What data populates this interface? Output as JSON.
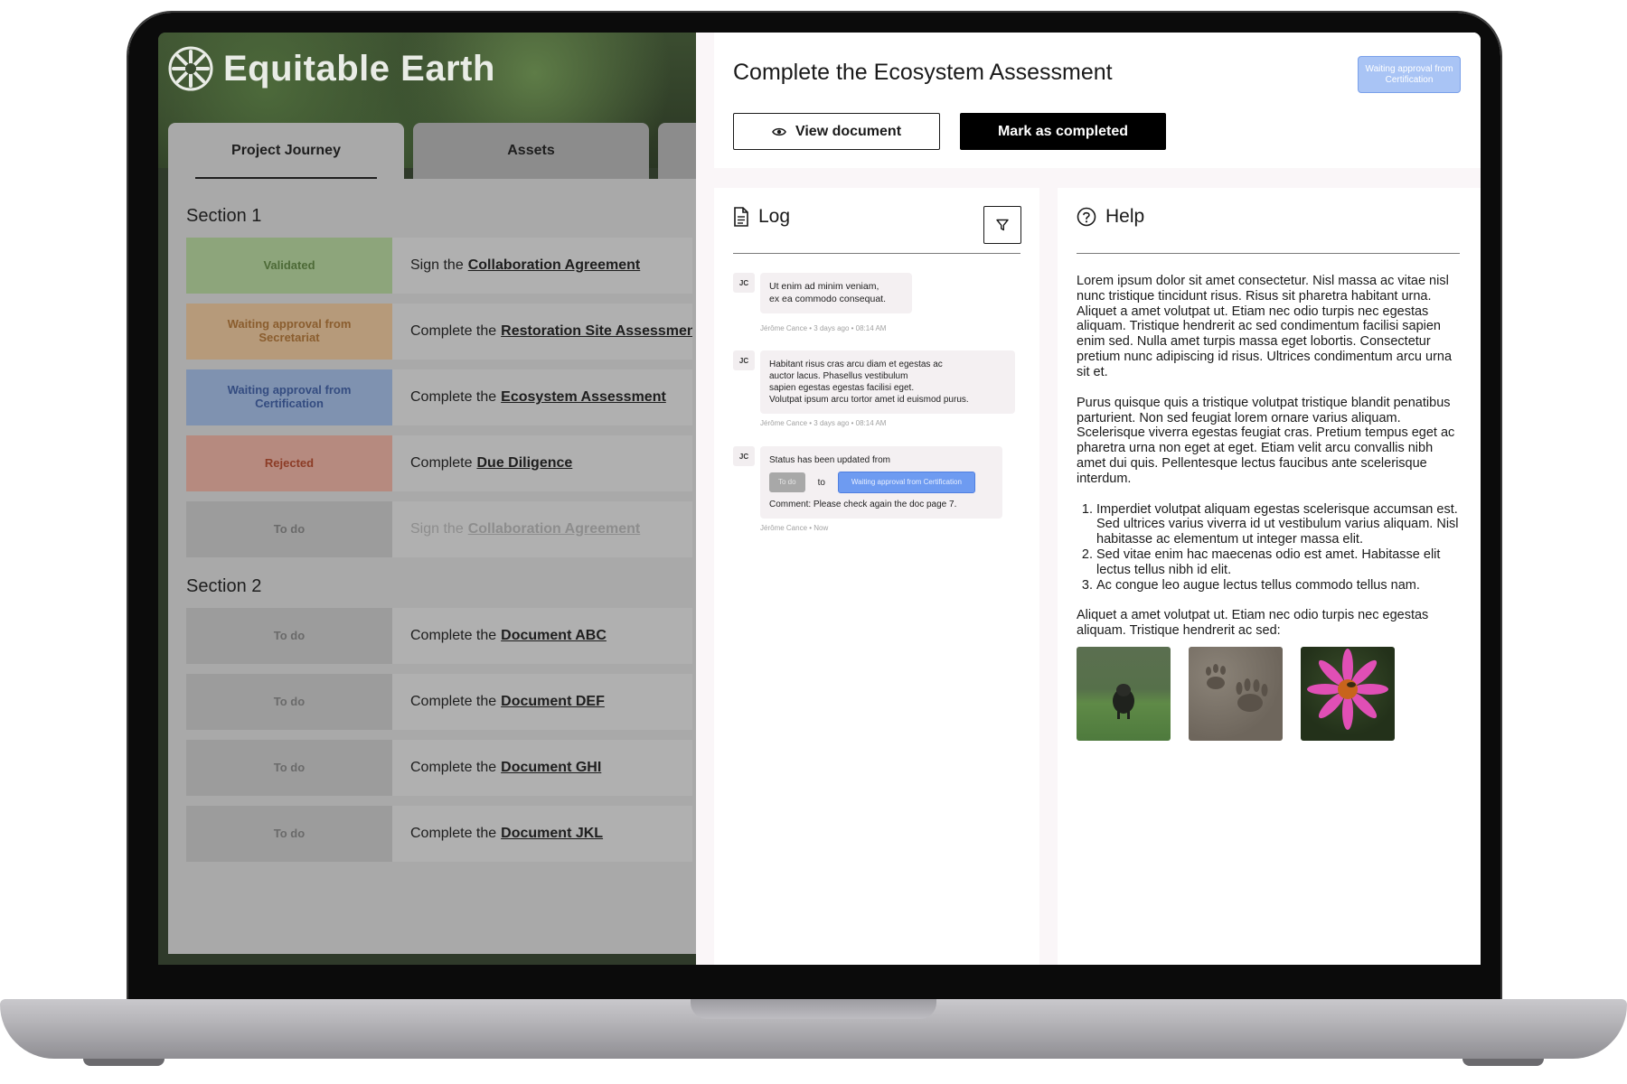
{
  "app": {
    "logo_text": "Equitable Earth",
    "tabs": [
      "Project Journey",
      "Assets"
    ]
  },
  "journey": {
    "sections": [
      {
        "title": "Section 1",
        "rows": [
          {
            "status": "Validated",
            "prefix": "Sign the",
            "doc": "Collaboration Agreement"
          },
          {
            "status": "Waiting approval from Secretariat",
            "prefix": "Complete the",
            "doc": "Restoration Site Assessment"
          },
          {
            "status": "Waiting approval from Certification",
            "prefix": "Complete the",
            "doc": "Ecosystem Assessment"
          },
          {
            "status": "Rejected",
            "prefix": "Complete",
            "doc": "Due Diligence"
          },
          {
            "status": "To do",
            "prefix": "Sign the",
            "doc": "Collaboration Agreement"
          }
        ]
      },
      {
        "title": "Section 2",
        "rows": [
          {
            "status": "To do",
            "prefix": "Complete the",
            "doc": "Document ABC"
          },
          {
            "status": "To do",
            "prefix": "Complete the",
            "doc": "Document DEF"
          },
          {
            "status": "To do",
            "prefix": "Complete the",
            "doc": "Document GHI"
          },
          {
            "status": "To do",
            "prefix": "Complete the",
            "doc": "Document JKL"
          }
        ]
      }
    ]
  },
  "detail": {
    "title": "Complete the Ecosystem Assessment",
    "badge": "Waiting approval from Certification",
    "view_button": "View document",
    "complete_button": "Mark as completed"
  },
  "log": {
    "title": "Log",
    "entries": [
      {
        "initials": "JC",
        "lines": [
          "Ut enim ad minim veniam,",
          "ex ea commodo consequat."
        ],
        "meta": "Jérôme Cance • 3 days ago • 08:14 AM"
      },
      {
        "initials": "JC",
        "lines": [
          "Habitant risus cras arcu diam et egestas ac",
          "auctor lacus. Phasellus vestibulum",
          "sapien egestas egestas facilisi eget.",
          "Volutpat ipsum arcu tortor amet id euismod purus."
        ],
        "meta": "Jérôme Cance • 3 days ago • 08:14 AM"
      },
      {
        "initials": "JC",
        "status_text": "Status has been updated from",
        "from": "To do",
        "to_word": "to",
        "to": "Waiting approval from Certification",
        "comment": "Comment: Please check again the doc page 7.",
        "meta": "Jérôme Cance • Now"
      }
    ]
  },
  "help": {
    "title": "Help",
    "p1": "Lorem ipsum dolor sit amet consectetur. Nisl massa ac vitae nisl nunc tristique tincidunt risus. Risus sit pharetra habitant urna. Aliquet a amet volutpat ut. Etiam nec odio turpis nec egestas aliquam. Tristique hendrerit ac sed condimentum facilisi sapien enim sed. Nulla amet turpis massa eget lobortis. Consectetur pretium nunc adipiscing id risus. Ultrices condimentum arcu urna sit et.",
    "p2": "Purus quisque quis a tristique volutpat tristique blandit penatibus parturient. Non sed feugiat lorem ornare varius aliquam. Scelerisque viverra egestas feugiat cras. Pretium tempus eget ac pharetra urna non eget at eget. Etiam velit arcu convallis nibh amet dui quis. Pellentesque lectus faucibus ante scelerisque interdum.",
    "list": [
      "Imperdiet volutpat aliquam egestas scelerisque accumsan est. Sed ultrices varius viverra id ut vestibulum varius aliquam. Nisl habitasse ac elementum ut integer massa elit.",
      "Sed vitae enim hac maecenas odio est amet. Habitasse elit lectus tellus nibh id elit.",
      "Ac congue leo augue lectus tellus commodo tellus nam."
    ],
    "p3": "Aliquet a amet volutpat ut. Etiam nec odio turpis nec egestas aliquam. Tristique hendrerit ac sed:",
    "images": [
      "boar-photo",
      "animal-track-photo",
      "coneflower-photo"
    ]
  },
  "colors": {
    "validated": "#8da57b",
    "secretariat": "#b69a7a",
    "certification": "#7f92b0",
    "rejected": "#b68a7f",
    "todo": "#9c9c9c",
    "badge_blue": "#a9c4f5",
    "chip_blue": "#6e9bf1"
  }
}
